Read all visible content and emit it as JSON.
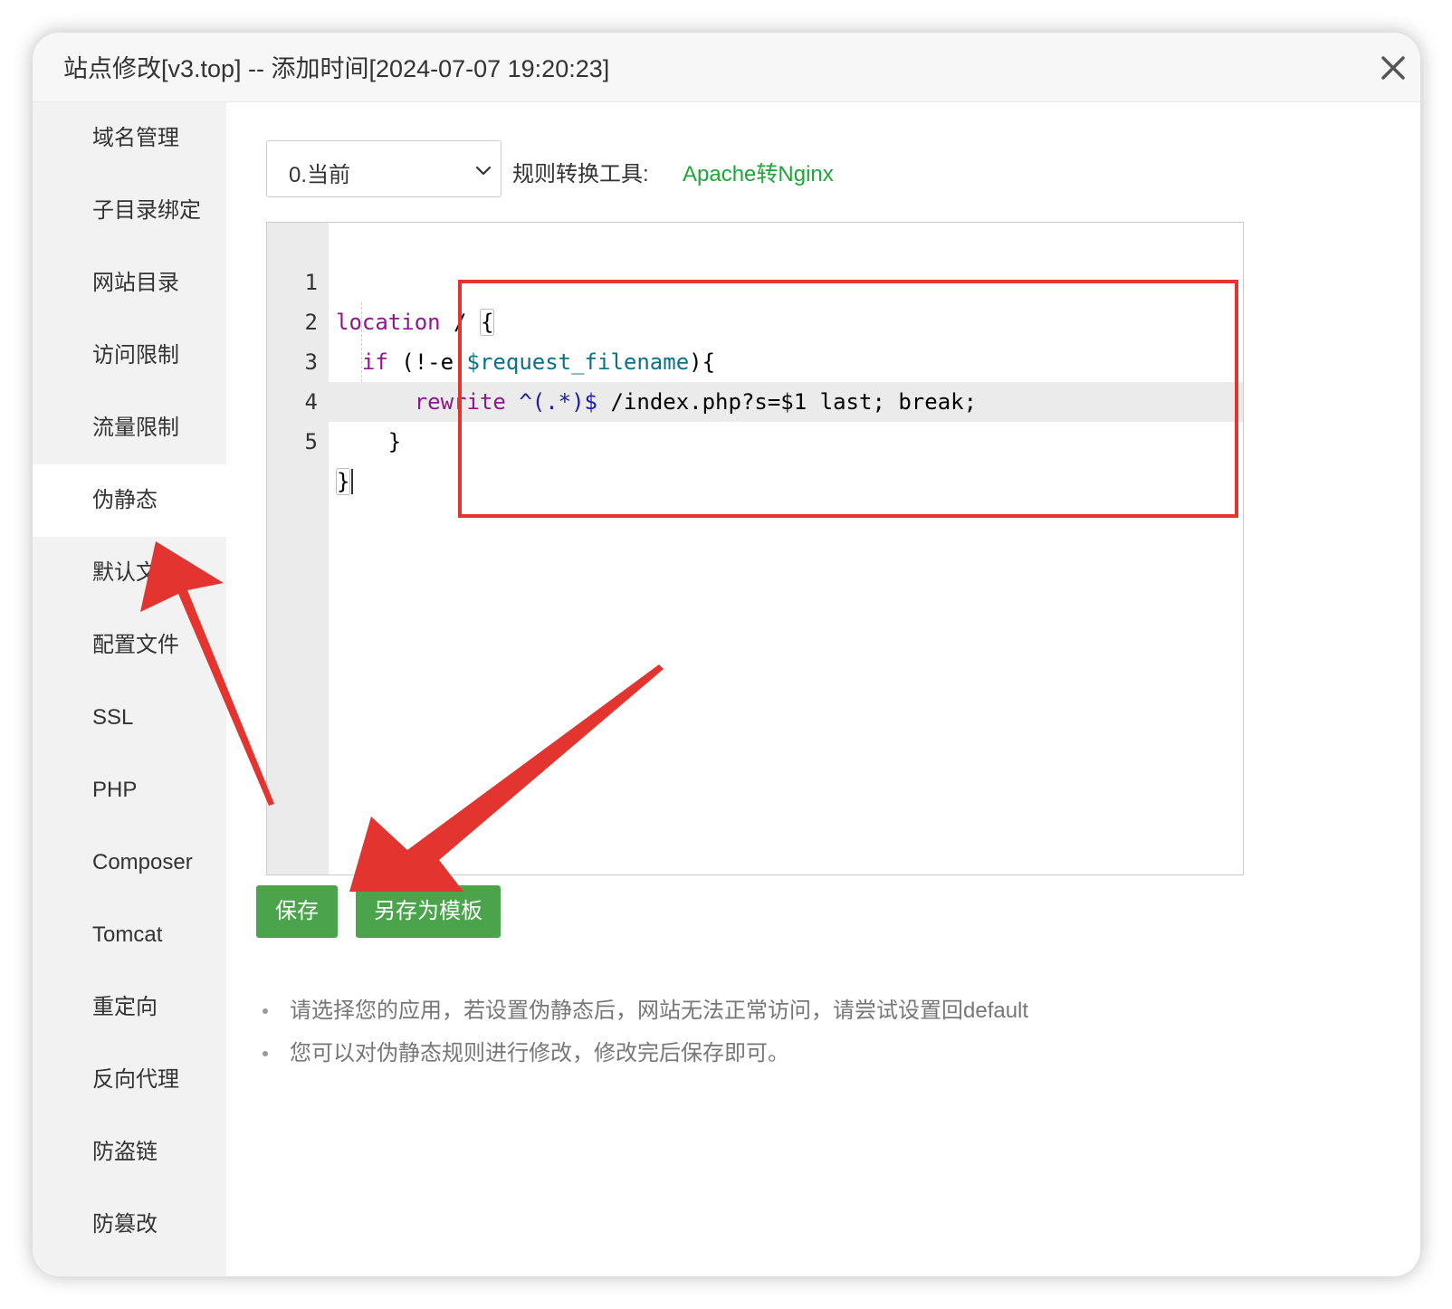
{
  "dialog": {
    "title": "站点修改[v3.top] -- 添加时间[2024-07-07 19:20:23]",
    "close_icon": "close-icon"
  },
  "sidebar": {
    "items": [
      {
        "label": "域名管理"
      },
      {
        "label": "子目录绑定"
      },
      {
        "label": "网站目录"
      },
      {
        "label": "访问限制"
      },
      {
        "label": "流量限制"
      },
      {
        "label": "伪静态",
        "active": true
      },
      {
        "label": "默认文"
      },
      {
        "label": "配置文件"
      },
      {
        "label": "SSL"
      },
      {
        "label": "PHP"
      },
      {
        "label": "Composer"
      },
      {
        "label": "Tomcat"
      },
      {
        "label": "重定向"
      },
      {
        "label": "反向代理"
      },
      {
        "label": "防盗链"
      },
      {
        "label": "防篡改"
      }
    ]
  },
  "rewrite": {
    "select_value": "0.当前",
    "tool_label": "规则转换工具:",
    "tool_link": "Apache转Nginx",
    "editor": {
      "line_numbers": [
        "1",
        "2",
        "3",
        "4",
        "5"
      ],
      "line1": {
        "kw": "location",
        "rest": " / ",
        "brace": "{"
      },
      "line2": {
        "indent": "  ",
        "kw": "if",
        "mid": " (!-e ",
        "var": "$request_filename",
        "end": "){"
      },
      "line3": {
        "indent": "      ",
        "kw": "rewrite",
        "sp": " ",
        "re": "^(.*)$",
        "rest": " /index.php?s=$1 last; break;"
      },
      "line4": {
        "text": "    }"
      },
      "line5": {
        "brace": "}"
      },
      "active_line": 5
    },
    "buttons": {
      "save": "保存",
      "save_template": "另存为模板"
    },
    "tips": [
      "请选择您的应用，若设置伪静态后，网站无法正常访问，请尝试设置回default",
      "您可以对伪静态规则进行修改，修改完后保存即可。"
    ]
  },
  "colors": {
    "accent_green": "#20a53a",
    "button_green": "#4ba44c",
    "annotation_red": "#e3342f"
  }
}
